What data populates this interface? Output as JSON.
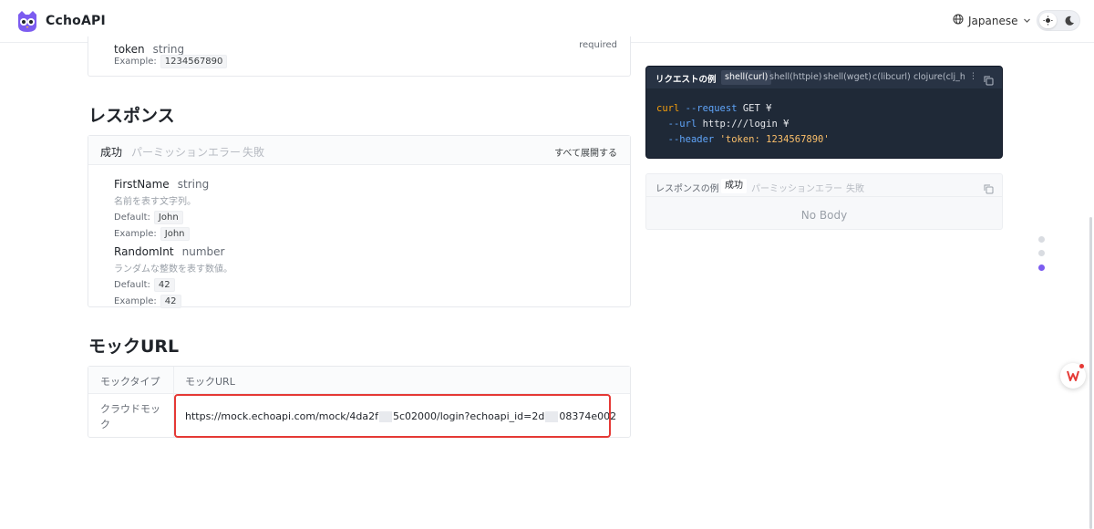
{
  "header": {
    "brand": "CchoAPI",
    "language": "Japanese"
  },
  "request_params": {
    "token": {
      "name": "token",
      "type": "string",
      "required": "required",
      "example_label": "Example:",
      "example_value": "1234567890"
    }
  },
  "response": {
    "title": "レスポンス",
    "tabs": [
      "成功",
      "パーミッションエラー",
      "失敗"
    ],
    "expand_all": "すべて展開する",
    "fields": [
      {
        "name": "FirstName",
        "type": "string",
        "description": "名前を表す文字列。",
        "default_label": "Default:",
        "default_value": "John",
        "example_label": "Example:",
        "example_value": "John"
      },
      {
        "name": "RandomInt",
        "type": "number",
        "description": "ランダムな整数を表す数値。",
        "default_label": "Default:",
        "default_value": "42",
        "example_label": "Example:",
        "example_value": "42"
      }
    ]
  },
  "mock": {
    "title": "モックURL",
    "col_type": "モックタイプ",
    "col_url": "モックURL",
    "row_type": "クラウドモック",
    "url_part1": "https://mock.echoapi.com/mock/4da2f",
    "url_part2": "5c02000/login?echoapi_id=2d",
    "url_part3": "08374e002"
  },
  "request_example": {
    "label": "リクエストの例",
    "tabs": [
      "shell(curl)",
      "shell(httpie)",
      "shell(wget)",
      "c(libcurl)",
      "clojure(clj_htt"
    ],
    "more": "⋮",
    "code": {
      "l1_cmd": "curl",
      "l1_flag": "--request",
      "l1_rest": " GET ¥",
      "l2_flag": "--url",
      "l2_rest": " http:///login ¥",
      "l3_flag": "--header",
      "l3_str": "'token: 1234567890'"
    }
  },
  "response_example": {
    "label": "レスポンスの例",
    "tabs": [
      "成功",
      "パーミッションエラー",
      "失敗"
    ],
    "no_body": "No Body"
  },
  "colors": {
    "accent": "#7c5cf0",
    "highlight": "#e53935",
    "code_bg": "#1f2937"
  }
}
